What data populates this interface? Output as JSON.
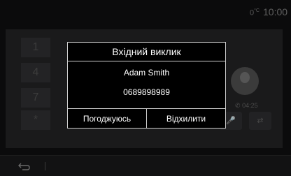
{
  "status": {
    "temperature": "0",
    "temp_unit": "°C",
    "time": "10:00"
  },
  "keypad": [
    "1",
    "4",
    "7",
    "*"
  ],
  "call_timer": "04:25",
  "dialog": {
    "title": "Вхідний виклик",
    "caller_name": "Adam Smith",
    "caller_number": "0689898989",
    "accept_label": "Погоджуюсь",
    "decline_label": "Відхилити"
  },
  "colors": {
    "dialog_border": "#cfcfcf",
    "background": "#0b0b0c"
  }
}
